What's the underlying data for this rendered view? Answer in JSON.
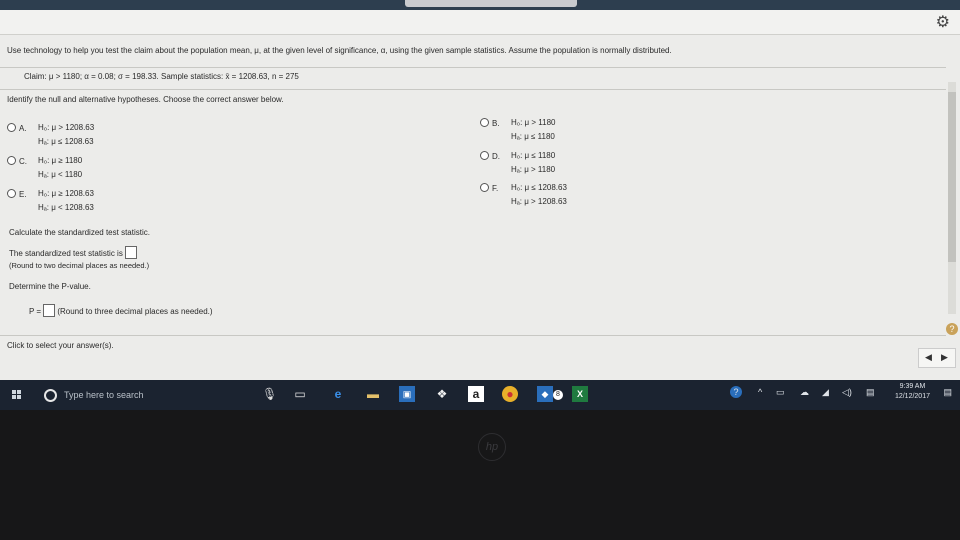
{
  "instruction": "Use technology to help you test the claim about the population mean, μ, at the given level of significance, α, using the given sample statistics. Assume the population is normally distributed.",
  "claim_line": "Claim: μ > 1180; α = 0.08; σ = 198.33. Sample statistics: x̄ = 1208.63, n = 275",
  "hypotheses_prompt": "Identify the null and alternative hypotheses. Choose the correct answer below.",
  "options": [
    {
      "letter": "A.",
      "h0": "H₀: μ > 1208.63",
      "ha": "Hₐ: μ ≤ 1208.63"
    },
    {
      "letter": "B.",
      "h0": "H₀: μ > 1180",
      "ha": "Hₐ: μ ≤ 1180"
    },
    {
      "letter": "C.",
      "h0": "H₀: μ ≥ 1180",
      "ha": "Hₐ: μ < 1180"
    },
    {
      "letter": "D.",
      "h0": "H₀: μ ≤ 1180",
      "ha": "Hₐ: μ > 1180"
    },
    {
      "letter": "E.",
      "h0": "H₀: μ ≥ 1208.63",
      "ha": "Hₐ: μ < 1208.63"
    },
    {
      "letter": "F.",
      "h0": "H₀: μ ≤ 1208.63",
      "ha": "Hₐ: μ > 1208.63"
    }
  ],
  "calc_prompt": "Calculate the standardized test statistic.",
  "stat_label": "The standardized test statistic is",
  "stat_round": "(Round to two decimal places as needed.)",
  "pvalue_prompt": "Determine the P-value.",
  "p_label": "P =",
  "p_round": "(Round to three decimal places as needed.)",
  "footer_hint": "Click to select your answer(s).",
  "taskbar": {
    "search_placeholder": "Type here to search",
    "time": "9:39 AM",
    "date": "12/12/2017",
    "badge": "8"
  },
  "brand": "hp",
  "colors": {
    "accent": "#2a6ebb",
    "taskbar": "#1b2330"
  }
}
